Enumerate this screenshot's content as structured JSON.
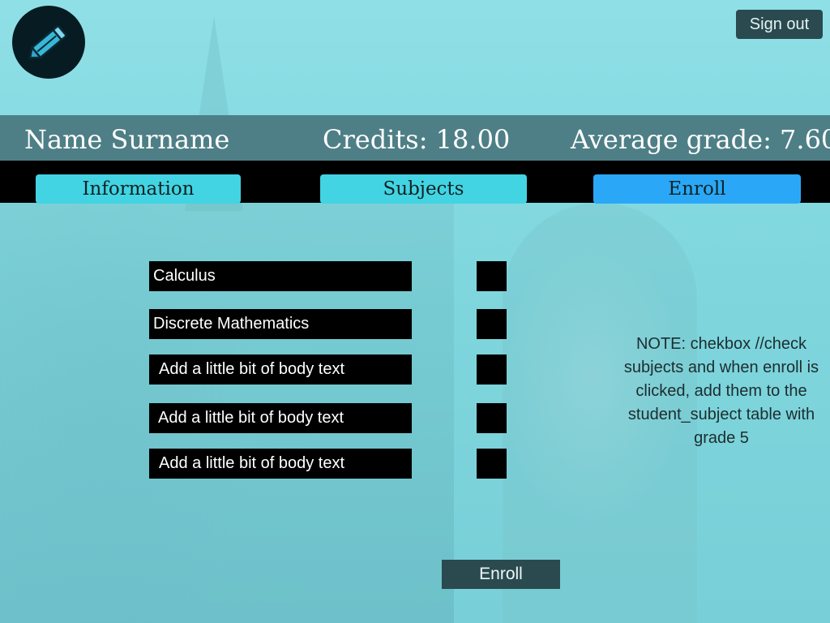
{
  "header": {
    "sign_out": "Sign out",
    "name": "Name Surname",
    "credits": "Credits: 18.00",
    "average": "Average grade: 7.60"
  },
  "tabs": [
    {
      "label": "Information",
      "color": "#42d4e3"
    },
    {
      "label": "Subjects",
      "color": "#42d4e3"
    },
    {
      "label": "Enroll",
      "color": "#2aa8f7"
    }
  ],
  "subjects": [
    {
      "label": "Calculus"
    },
    {
      "label": "Discrete Mathematics"
    },
    {
      "label": "Add a little bit of body text"
    },
    {
      "label": "Add a little bit of body text"
    },
    {
      "label": "Add a little bit of body text"
    }
  ],
  "note": "NOTE: chekbox //check subjects and when enroll is clicked, add them to the student_subject table with grade 5",
  "enroll_button": "Enroll",
  "icons": {
    "logo": "pencil-icon"
  }
}
